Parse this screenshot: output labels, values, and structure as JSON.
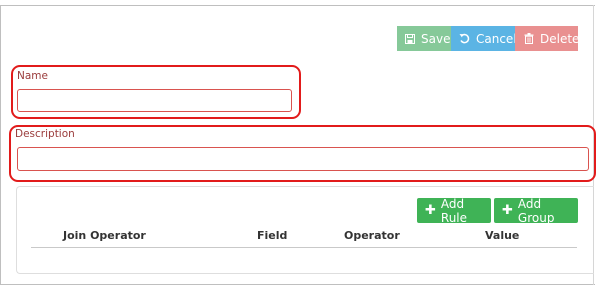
{
  "toolbar": {
    "save_label": "Save",
    "cancel_label": "Cancel",
    "delete_label": "Delete"
  },
  "form": {
    "name_label": "Name",
    "name_value": "",
    "description_label": "Description",
    "description_value": ""
  },
  "rules": {
    "add_rule_label": "Add Rule",
    "add_group_label": "Add Group",
    "columns": [
      "Join Operator",
      "Field",
      "Operator",
      "Value"
    ]
  },
  "colors": {
    "save": "#86c999",
    "cancel": "#5bb4e4",
    "delete": "#e99090",
    "add": "#3fb356",
    "highlight": "#e21b1b",
    "label": "#9a3b3b"
  },
  "icons": {
    "save": "floppy-disk-icon",
    "cancel": "undo-icon",
    "delete": "trash-icon",
    "add": "plus-icon"
  }
}
